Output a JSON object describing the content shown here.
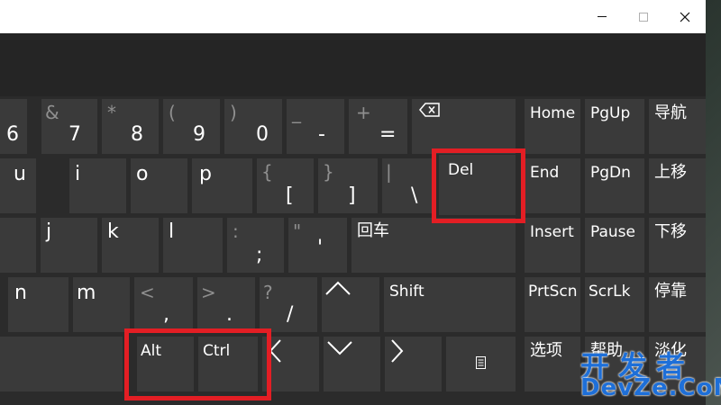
{
  "window": {
    "controls": {
      "minimize": "minimize",
      "maximize": "maximize",
      "close": "close"
    }
  },
  "keys": {
    "k6": {
      "main": "6"
    },
    "k7": {
      "main": "7",
      "shift": "&"
    },
    "k8": {
      "main": "8",
      "shift": "*"
    },
    "k9": {
      "main": "9",
      "shift": "("
    },
    "k0": {
      "main": "0",
      "shift": ")"
    },
    "minus": {
      "main": "-",
      "shift": "_"
    },
    "equals": {
      "main": "=",
      "shift": "+"
    },
    "u": {
      "main": "u"
    },
    "i": {
      "main": "i"
    },
    "o": {
      "main": "o"
    },
    "p": {
      "main": "p"
    },
    "lbracket": {
      "main": "[",
      "shift": "{"
    },
    "rbracket": {
      "main": "]",
      "shift": "}"
    },
    "backslash": {
      "main": "\\",
      "shift": "|"
    },
    "del": {
      "label": "Del"
    },
    "j": {
      "main": "j"
    },
    "k": {
      "main": "k"
    },
    "l": {
      "main": "l"
    },
    "semicolon": {
      "main": ";",
      "shift": ":"
    },
    "quote": {
      "main": "'",
      "shift": "\""
    },
    "enter": {
      "label": "回车"
    },
    "n": {
      "main": "n"
    },
    "m": {
      "main": "m"
    },
    "comma": {
      "main": ",",
      "shift": "<"
    },
    "period": {
      "main": ".",
      "shift": ">"
    },
    "slash": {
      "main": "/",
      "shift": "?"
    },
    "shift": {
      "label": "Shift"
    },
    "alt": {
      "label": "Alt"
    },
    "ctrl": {
      "label": "Ctrl"
    },
    "home": {
      "label": "Home"
    },
    "pgup": {
      "label": "PgUp"
    },
    "nav": {
      "label": "导航"
    },
    "end": {
      "label": "End"
    },
    "pgdn": {
      "label": "PgDn"
    },
    "moveup": {
      "label": "上移"
    },
    "insert": {
      "label": "Insert"
    },
    "pause": {
      "label": "Pause"
    },
    "movedown": {
      "label": "下移"
    },
    "prtscn": {
      "label": "PrtScn"
    },
    "scrlk": {
      "label": "ScrLk"
    },
    "dock": {
      "label": "停靠"
    },
    "options": {
      "label": "选项"
    },
    "help": {
      "label": "帮助"
    },
    "fade": {
      "label": "淡化"
    }
  },
  "watermark": {
    "cn": "开发者",
    "en": "DevZe.CoM"
  },
  "colors": {
    "key_bg": "#3a3a3a",
    "window_bg": "#2b2b2b",
    "highlight": "#e31e24",
    "watermark": "#1e6fd8"
  }
}
